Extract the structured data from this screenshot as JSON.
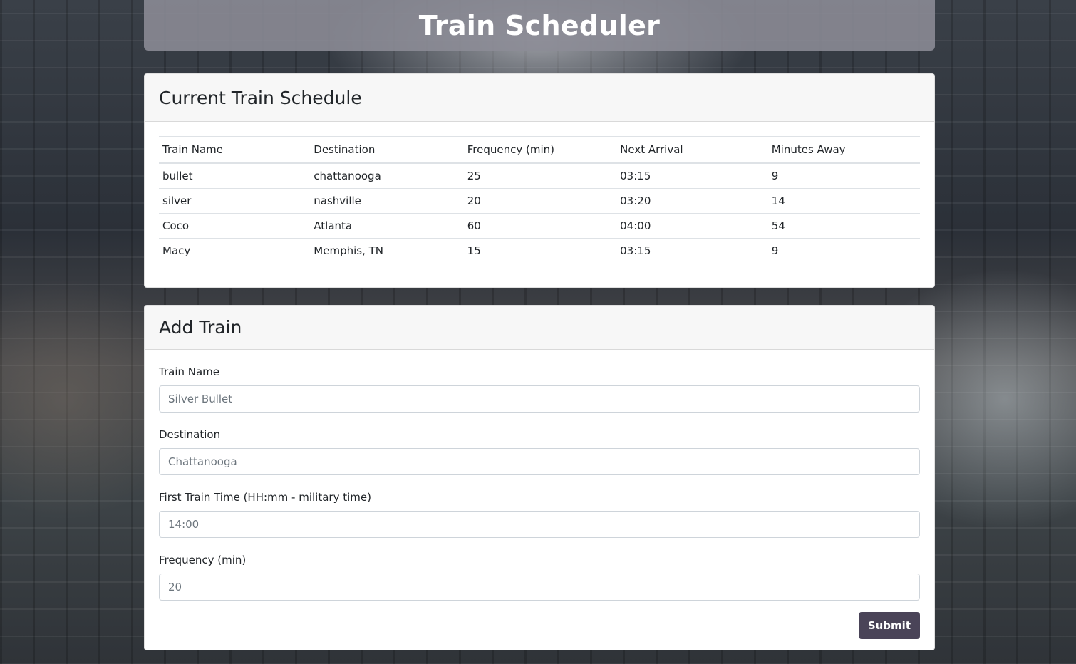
{
  "app": {
    "title": "Train Scheduler"
  },
  "schedule": {
    "heading": "Current Train Schedule",
    "columns": [
      "Train Name",
      "Destination",
      "Frequency (min)",
      "Next Arrival",
      "Minutes Away"
    ],
    "rows": [
      [
        "bullet",
        "chattanooga",
        "25",
        "03:15",
        "9"
      ],
      [
        "silver",
        "nashville",
        "20",
        "03:20",
        "14"
      ],
      [
        "Coco",
        "Atlanta",
        "60",
        "04:00",
        "54"
      ],
      [
        "Macy",
        "Memphis, TN",
        "15",
        "03:15",
        "9"
      ]
    ]
  },
  "add_train": {
    "heading": "Add Train",
    "fields": {
      "train_name": {
        "label": "Train Name",
        "placeholder": "Silver Bullet"
      },
      "destination": {
        "label": "Destination",
        "placeholder": "Chattanooga"
      },
      "first_time": {
        "label": "First Train Time (HH:mm - military time)",
        "placeholder": "14:00"
      },
      "frequency": {
        "label": "Frequency (min)",
        "placeholder": "20"
      }
    },
    "submit_label": "Submit"
  },
  "colors": {
    "header_bg": "#8c8c96",
    "submit_bg": "#4a4458",
    "card_header_bg": "#f7f7f7"
  }
}
